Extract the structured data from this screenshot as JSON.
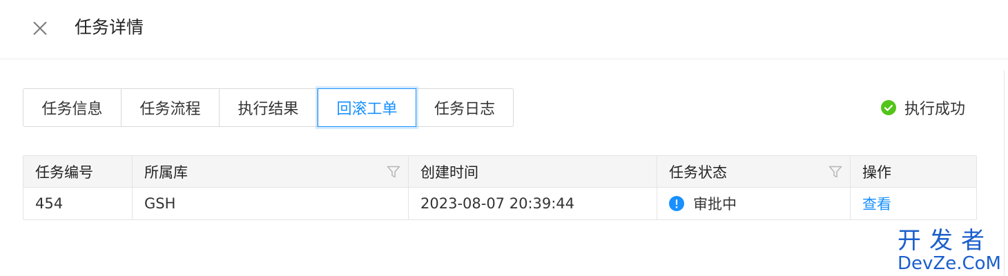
{
  "header": {
    "title": "任务详情",
    "close_icon": "close-icon"
  },
  "tabs": [
    {
      "label": "任务信息",
      "active": false
    },
    {
      "label": "任务流程",
      "active": false
    },
    {
      "label": "执行结果",
      "active": false
    },
    {
      "label": "回滚工单",
      "active": true
    },
    {
      "label": "任务日志",
      "active": false
    }
  ],
  "status": {
    "icon": "check-circle-icon",
    "text": "执行成功",
    "color": "#52c41a"
  },
  "table": {
    "columns": [
      {
        "label": "任务编号",
        "filter": false
      },
      {
        "label": "所属库",
        "filter": true
      },
      {
        "label": "创建时间",
        "filter": false
      },
      {
        "label": "任务状态",
        "filter": true
      },
      {
        "label": "操作",
        "filter": false
      }
    ],
    "rows": [
      {
        "id": "454",
        "database": "GSH",
        "created_at": "2023-08-07 20:39:44",
        "state": "审批中",
        "state_icon": "info-circle-icon",
        "state_color": "#1890ff",
        "action": "查看"
      }
    ]
  },
  "watermark": {
    "cn": "开发者",
    "en": "DevZe.CoM"
  },
  "colors": {
    "accent": "#1890ff",
    "success": "#52c41a",
    "watermark": "#1a5fcc"
  }
}
